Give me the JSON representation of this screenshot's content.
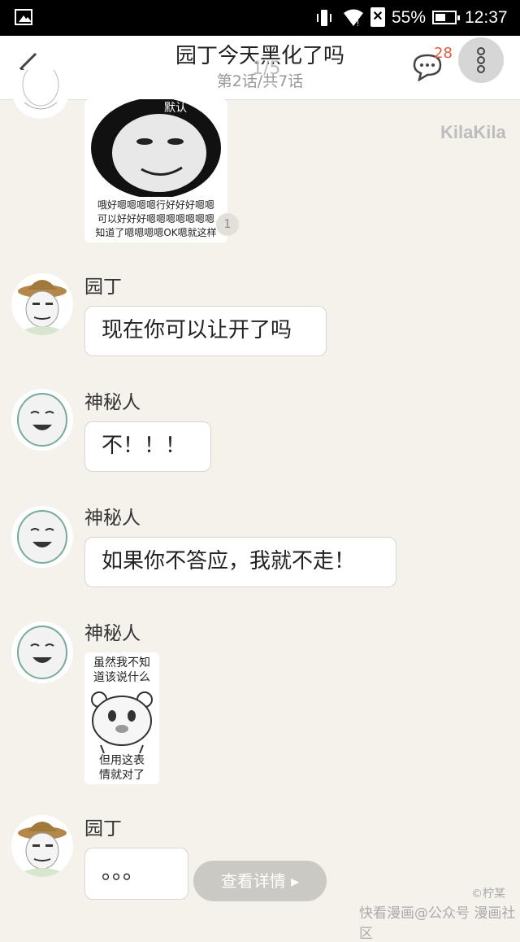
{
  "status_bar": {
    "battery_percent": "55%",
    "time": "12:37",
    "battery_level": 0.55,
    "icons": [
      "gallery-icon",
      "vibrate-icon",
      "wifi-icon",
      "sim-icon",
      "battery-icon"
    ]
  },
  "header": {
    "title": "园丁今天黑化了吗",
    "subtitle": "第2话/共7话",
    "comment_count": "28",
    "page_indicator": "1/5",
    "icons": [
      "back-icon",
      "comment-icon",
      "more-icon"
    ]
  },
  "watermark": "KilaKila",
  "messages": [
    {
      "sender": "",
      "type": "sticker",
      "caption_top": "默认",
      "caption_lines": [
        "哦好嗯嗯嗯嗯行好好好嗯嗯",
        "可以好好好嗯嗯嗯嗯嗯嗯嗯",
        "知道了嗯嗯嗯嗯OK嗯就这样"
      ],
      "reply_count": "1"
    },
    {
      "sender": "园丁",
      "type": "text",
      "text": "现在你可以让开了吗"
    },
    {
      "sender": "神秘人",
      "type": "text",
      "text": "不！！！"
    },
    {
      "sender": "神秘人",
      "type": "text",
      "text": "如果你不答应，我就不走！"
    },
    {
      "sender": "神秘人",
      "type": "sticker",
      "caption_lines_top": [
        "虽然我不知",
        "道该说什么"
      ],
      "caption_lines_bottom": [
        "但用这表",
        "情就对了"
      ]
    },
    {
      "sender": "园丁",
      "type": "text",
      "text": "。。。"
    }
  ],
  "detail_button": "查看详情 ▸",
  "credit": "©柠某",
  "footer_watermark": "快看漫画@公众号 漫画社区"
}
